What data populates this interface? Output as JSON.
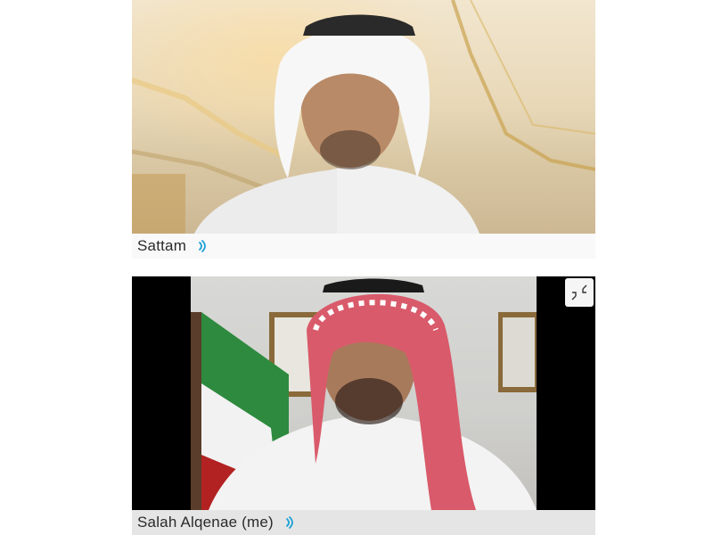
{
  "participants": [
    {
      "name": "Sattam",
      "speaker_icon": "audio-wave-icon",
      "accent": "#1ba1d6"
    },
    {
      "name": "Salah Alqenae (me)",
      "speaker_icon": "audio-wave-icon",
      "accent": "#1ba1d6"
    }
  ],
  "controls": {
    "collapse_icon": "collapse-arrows-icon"
  }
}
